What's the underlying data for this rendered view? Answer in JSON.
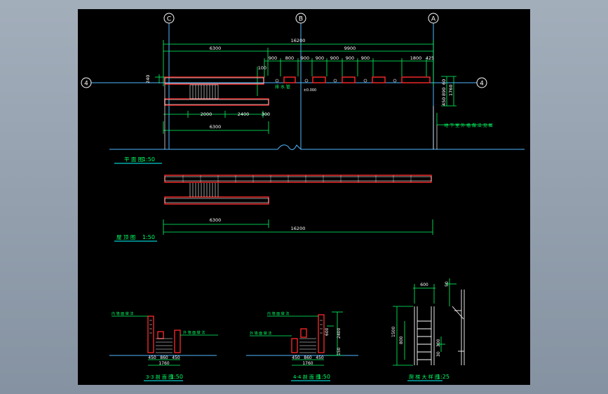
{
  "colors": {
    "background": "#000000",
    "frame": "#96a2b0",
    "dimension_lines": "#00ff66",
    "text": "#ffffff",
    "walls": "#ff2a2a",
    "axis_lines": "#4fb8ff",
    "title_underline": "#00ffff"
  },
  "axes": {
    "c": "C",
    "b": "B",
    "a": "A",
    "row4": "4"
  },
  "plan": {
    "dim_total": "16200",
    "dim_left": "6300",
    "dim_right": "9900",
    "segments": [
      "900",
      "800",
      "900",
      "900",
      "900",
      "900",
      "900",
      "1800",
      "425"
    ],
    "left_small": "100",
    "left_small2": "240",
    "right_dims": [
      "60",
      "890",
      "1760",
      "450"
    ],
    "lower_dims": [
      "2000",
      "2400",
      "300"
    ],
    "lower_total": "6300",
    "label_drain": "排 水 管",
    "label_right": "地 下 室 外 墙 做 法 见 图",
    "label_small": "±0.000",
    "title": "平 面 图",
    "scale": "1:50"
  },
  "roof": {
    "dim_left": "6300",
    "dim_total": "16200",
    "title": "屋 顶 图",
    "scale": "1:50"
  },
  "section_left": {
    "note1": "内 墙 面 做 法",
    "note2": "外 墙 面 做 法",
    "dims": [
      "450",
      "860",
      "450"
    ],
    "total": "1760",
    "title": "3-3 剖 面 图",
    "scale": "1:50"
  },
  "section_right": {
    "note1": "内 墙 面 做 法",
    "note2": "外 墙 面 做 法",
    "dims": [
      "450",
      "860",
      "450"
    ],
    "total": "1760",
    "vert_dims": [
      "600",
      "2400",
      "150"
    ],
    "title": "4-4 剖 面 图",
    "scale": "1:50"
  },
  "ladder": {
    "dim_top": "600",
    "dim_side": "1500",
    "dim_inner": "800",
    "dim_r1": "300",
    "dim_r2": "30",
    "dim_top_small": "50",
    "title": "爬 梯 大 样 图",
    "scale": "1:25"
  }
}
